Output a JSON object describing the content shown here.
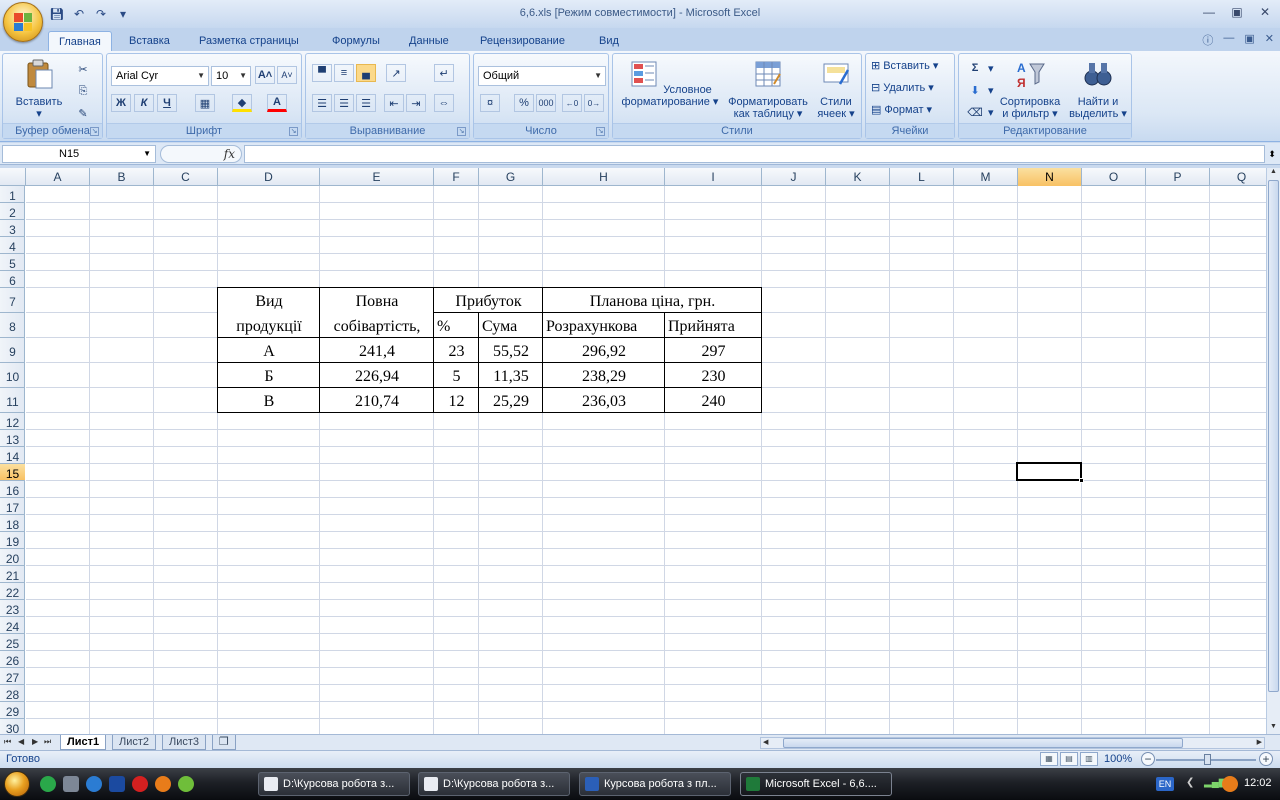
{
  "window": {
    "title": "6,6.xls  [Режим совместимости] - Microsoft Excel"
  },
  "ribbon_tabs": [
    "Главная",
    "Вставка",
    "Разметка страницы",
    "Формулы",
    "Данные",
    "Рецензирование",
    "Вид"
  ],
  "ribbon": {
    "clipboard": {
      "title": "Буфер обмена",
      "paste": "Вставить"
    },
    "font": {
      "title": "Шрифт",
      "name": "Arial Cyr",
      "size": "10",
      "bold": "Ж",
      "italic": "К",
      "underline": "Ч"
    },
    "alignment": {
      "title": "Выравнивание"
    },
    "number": {
      "title": "Число",
      "format": "Общий",
      "percent": "%",
      "thousands": "000"
    },
    "styles": {
      "title": "Стили",
      "cond_format_1": "Условное",
      "cond_format_2": "форматирование",
      "table_format_1": "Форматировать",
      "table_format_2": "как таблицу",
      "cell_styles_1": "Стили",
      "cell_styles_2": "ячеек"
    },
    "cells": {
      "title": "Ячейки",
      "insert": "Вставить",
      "delete": "Удалить",
      "format": "Формат"
    },
    "editing": {
      "title": "Редактирование",
      "sort_1": "Сортировка",
      "sort_2": "и фильтр",
      "find_1": "Найти и",
      "find_2": "выделить"
    }
  },
  "formula_bar": {
    "name_box": "N15",
    "fx": "fx",
    "formula": ""
  },
  "columns": [
    "A",
    "B",
    "C",
    "D",
    "E",
    "F",
    "G",
    "H",
    "I",
    "J",
    "K",
    "L",
    "M",
    "N",
    "O",
    "P",
    "Q"
  ],
  "rows": [
    "1",
    "2",
    "3",
    "4",
    "5",
    "6",
    "7",
    "8",
    "9",
    "10",
    "11",
    "12",
    "13",
    "14",
    "15",
    "16",
    "17",
    "18",
    "19",
    "20",
    "21",
    "22",
    "23",
    "24",
    "25",
    "26",
    "27",
    "28",
    "29",
    "30"
  ],
  "selected_cell": {
    "column": "N",
    "row": "15"
  },
  "table": {
    "h_vid_1": "Вид",
    "h_vid_2": "продукції",
    "h_cost_1": "Повна",
    "h_cost_2": "собівартість,",
    "h_profit": "Прибуток",
    "h_price": "Планова ціна, грн.",
    "h_pct": "%",
    "h_sum": "Сума",
    "h_calc": "Розрахункова",
    "h_accepted": "Прийнята",
    "rows": [
      {
        "kind": "А",
        "cost": "241,4",
        "pct": "23",
        "sum": "55,52",
        "calc": "296,92",
        "accepted": "297"
      },
      {
        "kind": "Б",
        "cost": "226,94",
        "pct": "5",
        "sum": "11,35",
        "calc": "238,29",
        "accepted": "230"
      },
      {
        "kind": "В",
        "cost": "210,74",
        "pct": "12",
        "sum": "25,29",
        "calc": "236,03",
        "accepted": "240"
      }
    ]
  },
  "sheet_tabs": [
    "Лист1",
    "Лист2",
    "Лист3"
  ],
  "status": {
    "ready": "Готово",
    "zoom": "100%"
  },
  "taskbar": {
    "tasks": [
      "D:\\Курсова робота з...",
      "D:\\Курсова робота з...",
      "Курсова робота з пл...",
      "Microsoft Excel - 6,6...."
    ],
    "lang": "EN",
    "clock": "12:02"
  }
}
